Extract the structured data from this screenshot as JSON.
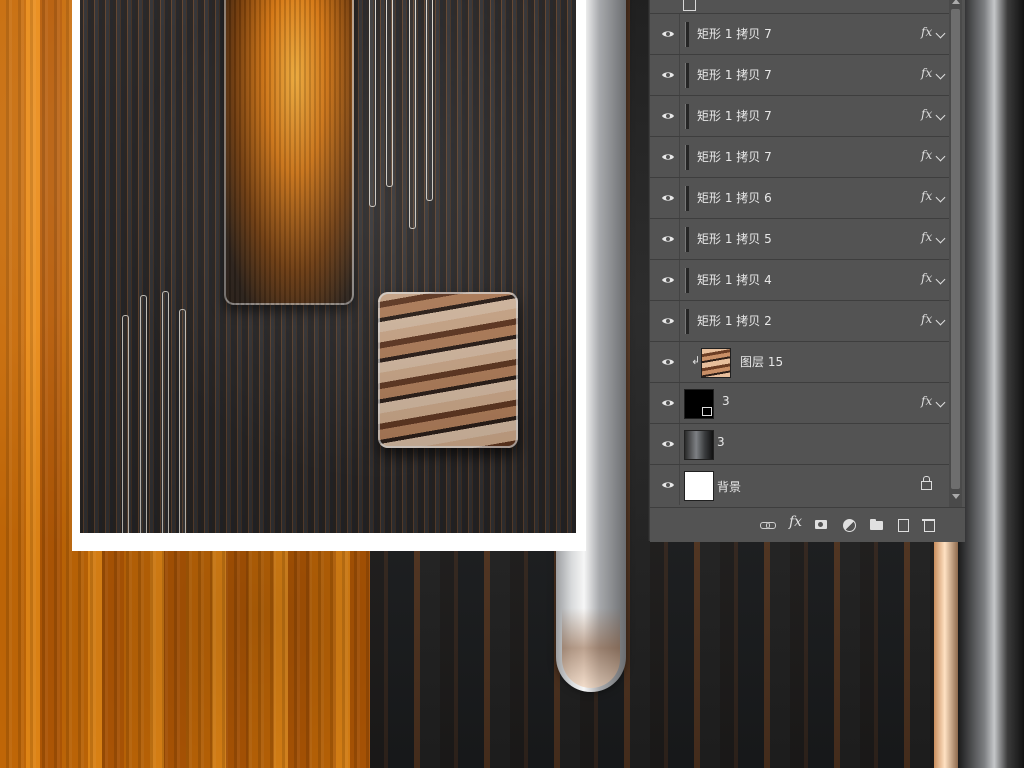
{
  "layers_panel": {
    "rows": [
      {
        "name": "矩形 1 拷贝 7",
        "fx": "fx"
      },
      {
        "name": "矩形 1 拷贝 7",
        "fx": "fx"
      },
      {
        "name": "矩形 1 拷贝 7",
        "fx": "fx"
      },
      {
        "name": "矩形 1 拷贝 7",
        "fx": "fx"
      },
      {
        "name": "矩形 1 拷贝 6",
        "fx": "fx"
      },
      {
        "name": "矩形 1 拷贝 5",
        "fx": "fx"
      },
      {
        "name": "矩形 1 拷贝 4",
        "fx": "fx"
      },
      {
        "name": "矩形 1 拷贝 2",
        "fx": "fx"
      },
      {
        "name": "图层 15",
        "fx": ""
      },
      {
        "name": "3",
        "fx": "fx"
      },
      {
        "name": "3",
        "fx": ""
      },
      {
        "name": "背景",
        "fx": ""
      }
    ],
    "footer_fx": "fx"
  },
  "colors": {
    "panel_bg": "#535353",
    "accent_orange": "#e98a16",
    "wood_dark": "#222222"
  }
}
